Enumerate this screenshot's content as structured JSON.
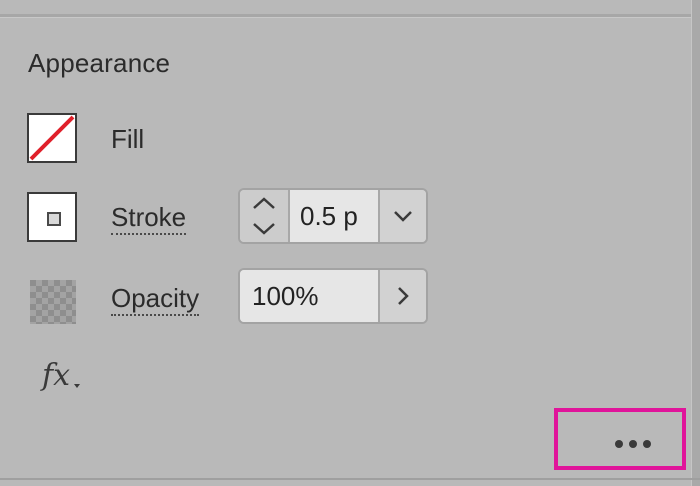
{
  "panel": {
    "title": "Appearance",
    "fill": {
      "label": "Fill",
      "swatch": "none",
      "slash_color": "#e0202a"
    },
    "stroke": {
      "label": "Stroke",
      "value": "0.5 p",
      "unit_options_icon": "chevron-down-icon"
    },
    "opacity": {
      "label": "Opacity",
      "value": "100%",
      "expand_icon": "chevron-right-icon"
    },
    "effects_button": {
      "label": "fx"
    },
    "more_options": {
      "icon": "more-horizontal-icon",
      "highlight_color": "#e0149a"
    }
  }
}
